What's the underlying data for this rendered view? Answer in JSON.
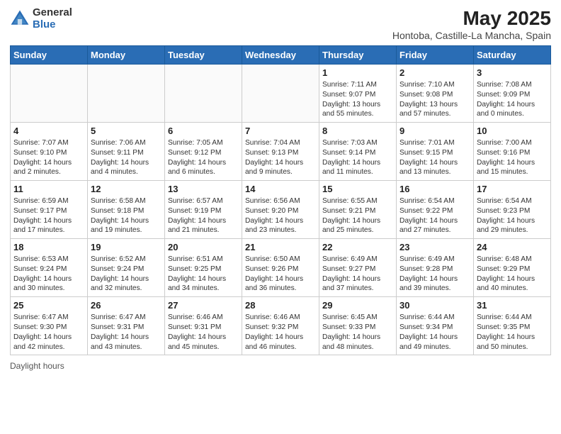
{
  "header": {
    "logo_general": "General",
    "logo_blue": "Blue",
    "title": "May 2025",
    "subtitle": "Hontoba, Castille-La Mancha, Spain"
  },
  "columns": [
    "Sunday",
    "Monday",
    "Tuesday",
    "Wednesday",
    "Thursday",
    "Friday",
    "Saturday"
  ],
  "footer": {
    "daylight_label": "Daylight hours"
  },
  "weeks": [
    [
      {
        "day": "",
        "sunrise": "",
        "sunset": "",
        "daylight": ""
      },
      {
        "day": "",
        "sunrise": "",
        "sunset": "",
        "daylight": ""
      },
      {
        "day": "",
        "sunrise": "",
        "sunset": "",
        "daylight": ""
      },
      {
        "day": "",
        "sunrise": "",
        "sunset": "",
        "daylight": ""
      },
      {
        "day": "1",
        "sunrise": "Sunrise: 7:11 AM",
        "sunset": "Sunset: 9:07 PM",
        "daylight": "Daylight: 13 hours and 55 minutes."
      },
      {
        "day": "2",
        "sunrise": "Sunrise: 7:10 AM",
        "sunset": "Sunset: 9:08 PM",
        "daylight": "Daylight: 13 hours and 57 minutes."
      },
      {
        "day": "3",
        "sunrise": "Sunrise: 7:08 AM",
        "sunset": "Sunset: 9:09 PM",
        "daylight": "Daylight: 14 hours and 0 minutes."
      }
    ],
    [
      {
        "day": "4",
        "sunrise": "Sunrise: 7:07 AM",
        "sunset": "Sunset: 9:10 PM",
        "daylight": "Daylight: 14 hours and 2 minutes."
      },
      {
        "day": "5",
        "sunrise": "Sunrise: 7:06 AM",
        "sunset": "Sunset: 9:11 PM",
        "daylight": "Daylight: 14 hours and 4 minutes."
      },
      {
        "day": "6",
        "sunrise": "Sunrise: 7:05 AM",
        "sunset": "Sunset: 9:12 PM",
        "daylight": "Daylight: 14 hours and 6 minutes."
      },
      {
        "day": "7",
        "sunrise": "Sunrise: 7:04 AM",
        "sunset": "Sunset: 9:13 PM",
        "daylight": "Daylight: 14 hours and 9 minutes."
      },
      {
        "day": "8",
        "sunrise": "Sunrise: 7:03 AM",
        "sunset": "Sunset: 9:14 PM",
        "daylight": "Daylight: 14 hours and 11 minutes."
      },
      {
        "day": "9",
        "sunrise": "Sunrise: 7:01 AM",
        "sunset": "Sunset: 9:15 PM",
        "daylight": "Daylight: 14 hours and 13 minutes."
      },
      {
        "day": "10",
        "sunrise": "Sunrise: 7:00 AM",
        "sunset": "Sunset: 9:16 PM",
        "daylight": "Daylight: 14 hours and 15 minutes."
      }
    ],
    [
      {
        "day": "11",
        "sunrise": "Sunrise: 6:59 AM",
        "sunset": "Sunset: 9:17 PM",
        "daylight": "Daylight: 14 hours and 17 minutes."
      },
      {
        "day": "12",
        "sunrise": "Sunrise: 6:58 AM",
        "sunset": "Sunset: 9:18 PM",
        "daylight": "Daylight: 14 hours and 19 minutes."
      },
      {
        "day": "13",
        "sunrise": "Sunrise: 6:57 AM",
        "sunset": "Sunset: 9:19 PM",
        "daylight": "Daylight: 14 hours and 21 minutes."
      },
      {
        "day": "14",
        "sunrise": "Sunrise: 6:56 AM",
        "sunset": "Sunset: 9:20 PM",
        "daylight": "Daylight: 14 hours and 23 minutes."
      },
      {
        "day": "15",
        "sunrise": "Sunrise: 6:55 AM",
        "sunset": "Sunset: 9:21 PM",
        "daylight": "Daylight: 14 hours and 25 minutes."
      },
      {
        "day": "16",
        "sunrise": "Sunrise: 6:54 AM",
        "sunset": "Sunset: 9:22 PM",
        "daylight": "Daylight: 14 hours and 27 minutes."
      },
      {
        "day": "17",
        "sunrise": "Sunrise: 6:54 AM",
        "sunset": "Sunset: 9:23 PM",
        "daylight": "Daylight: 14 hours and 29 minutes."
      }
    ],
    [
      {
        "day": "18",
        "sunrise": "Sunrise: 6:53 AM",
        "sunset": "Sunset: 9:24 PM",
        "daylight": "Daylight: 14 hours and 30 minutes."
      },
      {
        "day": "19",
        "sunrise": "Sunrise: 6:52 AM",
        "sunset": "Sunset: 9:24 PM",
        "daylight": "Daylight: 14 hours and 32 minutes."
      },
      {
        "day": "20",
        "sunrise": "Sunrise: 6:51 AM",
        "sunset": "Sunset: 9:25 PM",
        "daylight": "Daylight: 14 hours and 34 minutes."
      },
      {
        "day": "21",
        "sunrise": "Sunrise: 6:50 AM",
        "sunset": "Sunset: 9:26 PM",
        "daylight": "Daylight: 14 hours and 36 minutes."
      },
      {
        "day": "22",
        "sunrise": "Sunrise: 6:49 AM",
        "sunset": "Sunset: 9:27 PM",
        "daylight": "Daylight: 14 hours and 37 minutes."
      },
      {
        "day": "23",
        "sunrise": "Sunrise: 6:49 AM",
        "sunset": "Sunset: 9:28 PM",
        "daylight": "Daylight: 14 hours and 39 minutes."
      },
      {
        "day": "24",
        "sunrise": "Sunrise: 6:48 AM",
        "sunset": "Sunset: 9:29 PM",
        "daylight": "Daylight: 14 hours and 40 minutes."
      }
    ],
    [
      {
        "day": "25",
        "sunrise": "Sunrise: 6:47 AM",
        "sunset": "Sunset: 9:30 PM",
        "daylight": "Daylight: 14 hours and 42 minutes."
      },
      {
        "day": "26",
        "sunrise": "Sunrise: 6:47 AM",
        "sunset": "Sunset: 9:31 PM",
        "daylight": "Daylight: 14 hours and 43 minutes."
      },
      {
        "day": "27",
        "sunrise": "Sunrise: 6:46 AM",
        "sunset": "Sunset: 9:31 PM",
        "daylight": "Daylight: 14 hours and 45 minutes."
      },
      {
        "day": "28",
        "sunrise": "Sunrise: 6:46 AM",
        "sunset": "Sunset: 9:32 PM",
        "daylight": "Daylight: 14 hours and 46 minutes."
      },
      {
        "day": "29",
        "sunrise": "Sunrise: 6:45 AM",
        "sunset": "Sunset: 9:33 PM",
        "daylight": "Daylight: 14 hours and 48 minutes."
      },
      {
        "day": "30",
        "sunrise": "Sunrise: 6:44 AM",
        "sunset": "Sunset: 9:34 PM",
        "daylight": "Daylight: 14 hours and 49 minutes."
      },
      {
        "day": "31",
        "sunrise": "Sunrise: 6:44 AM",
        "sunset": "Sunset: 9:35 PM",
        "daylight": "Daylight: 14 hours and 50 minutes."
      }
    ]
  ]
}
